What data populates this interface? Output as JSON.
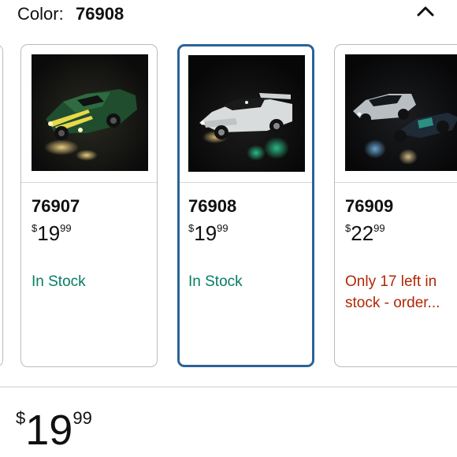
{
  "color_selector": {
    "label": "Color:",
    "selected_value": "76908",
    "collapse_icon": "chevron-up-icon"
  },
  "variants": [
    {
      "name": "76907",
      "price_symbol": "$",
      "price_whole": "19",
      "price_fraction": "99",
      "stock_text": "In Stock",
      "stock_status": "in-stock",
      "selected": false,
      "image": "green-sports-car-lego"
    },
    {
      "name": "76908",
      "price_symbol": "$",
      "price_whole": "19",
      "price_fraction": "99",
      "stock_text": "In Stock",
      "stock_status": "in-stock",
      "selected": true,
      "image": "white-lamborghini-lego"
    },
    {
      "name": "76909",
      "price_symbol": "$",
      "price_whole": "22",
      "price_fraction": "99",
      "stock_text": "Only 17 left in stock - order...",
      "stock_status": "low-stock",
      "selected": false,
      "image": "two-race-cars-lego"
    }
  ],
  "main_price": {
    "symbol": "$",
    "whole": "19",
    "fraction": "99"
  },
  "colors": {
    "selected_border": "#2a6496",
    "in_stock": "#067d62",
    "low_stock": "#b12704",
    "card_border": "#b8bcbd"
  }
}
